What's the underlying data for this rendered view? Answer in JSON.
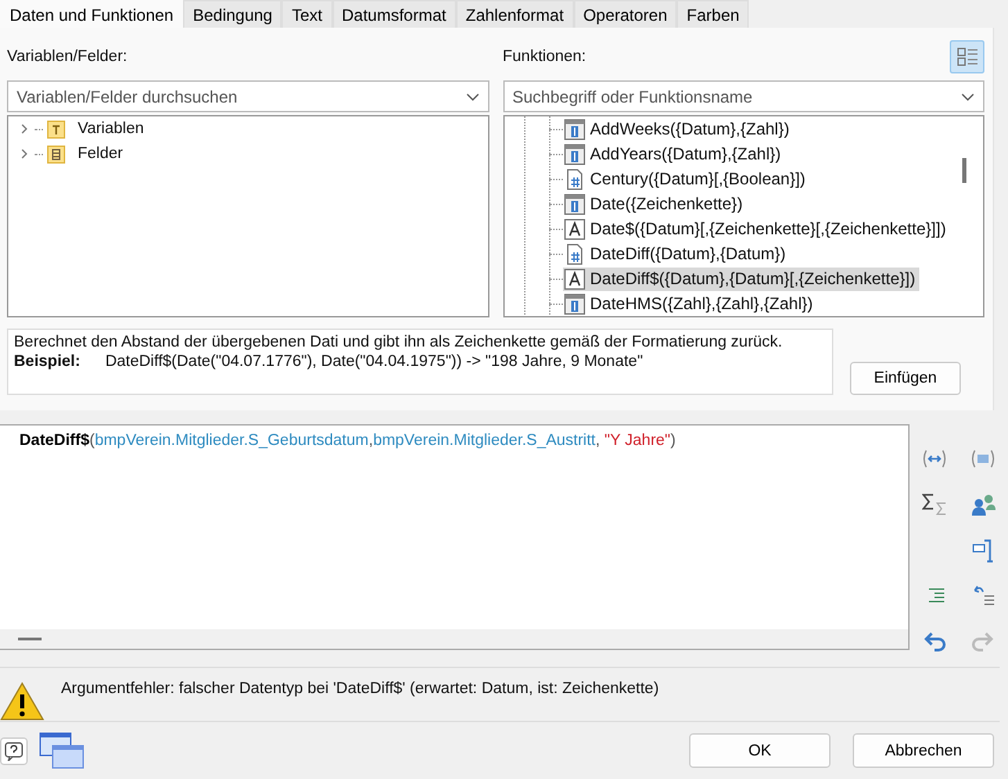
{
  "tabs": [
    {
      "label": "Daten und Funktionen",
      "selected": true
    },
    {
      "label": "Bedingung",
      "selected": false
    },
    {
      "label": "Text",
      "selected": false
    },
    {
      "label": "Datumsformat",
      "selected": false
    },
    {
      "label": "Zahlenformat",
      "selected": false
    },
    {
      "label": "Operatoren",
      "selected": false
    },
    {
      "label": "Farben",
      "selected": false
    }
  ],
  "variables_panel": {
    "label": "Variablen/Felder:",
    "search": {
      "placeholder": "Variablen/Felder durchsuchen"
    },
    "tree": [
      {
        "label": "Variablen",
        "kind": "variables",
        "expanded": false
      },
      {
        "label": "Felder",
        "kind": "fields",
        "expanded": false
      }
    ]
  },
  "functions_panel": {
    "label": "Funktionen:",
    "search": {
      "placeholder": "Suchbegriff oder Funktionsname"
    },
    "items": [
      {
        "label": "AddWeeks({Datum},{Zahl})",
        "kind": "date",
        "selected": false
      },
      {
        "label": "AddYears({Datum},{Zahl})",
        "kind": "date",
        "selected": false
      },
      {
        "label": "Century({Datum}[,{Boolean}])",
        "kind": "number",
        "selected": false
      },
      {
        "label": "Date({Zeichenkette})",
        "kind": "date",
        "selected": false
      },
      {
        "label": "Date$({Datum}[,{Zeichenkette}[,{Zeichenkette}]])",
        "kind": "string",
        "selected": false
      },
      {
        "label": "DateDiff({Datum},{Datum})",
        "kind": "number",
        "selected": false
      },
      {
        "label": "DateDiff$({Datum},{Datum}[,{Zeichenkette}])",
        "kind": "string",
        "selected": true
      },
      {
        "label": "DateHMS({Zahl},{Zahl},{Zahl})",
        "kind": "date",
        "selected": false
      }
    ]
  },
  "description": {
    "text": "Berechnet den Abstand der übergebenen Dati und gibt ihn als Zeichenkette gemäß der Formatierung zurück.",
    "example_label": "Beispiel:",
    "example": "DateDiff$(Date(\"04.07.1776\"), Date(\"04.04.1975\")) -> \"198 Jahre, 9 Monate\""
  },
  "insert_button": "Einfügen",
  "expression": [
    {
      "kind": "function",
      "text": "DateDiff$"
    },
    {
      "kind": "punct",
      "text": "("
    },
    {
      "kind": "field",
      "text": "bmpVerein.Mitglieder.S_Geburtsdatum"
    },
    {
      "kind": "punct",
      "text": ","
    },
    {
      "kind": "field",
      "text": "bmpVerein.Mitglieder.S_Austritt"
    },
    {
      "kind": "punct",
      "text": ", "
    },
    {
      "kind": "string",
      "text": "\"Y Jahre\""
    },
    {
      "kind": "punct",
      "text": ")"
    }
  ],
  "error_message": "Argumentfehler: falscher Datentyp bei 'DateDiff$' (erwartet: Datum, ist: Zeichenkette)",
  "buttons": [
    "OK",
    "Abbrechen"
  ]
}
